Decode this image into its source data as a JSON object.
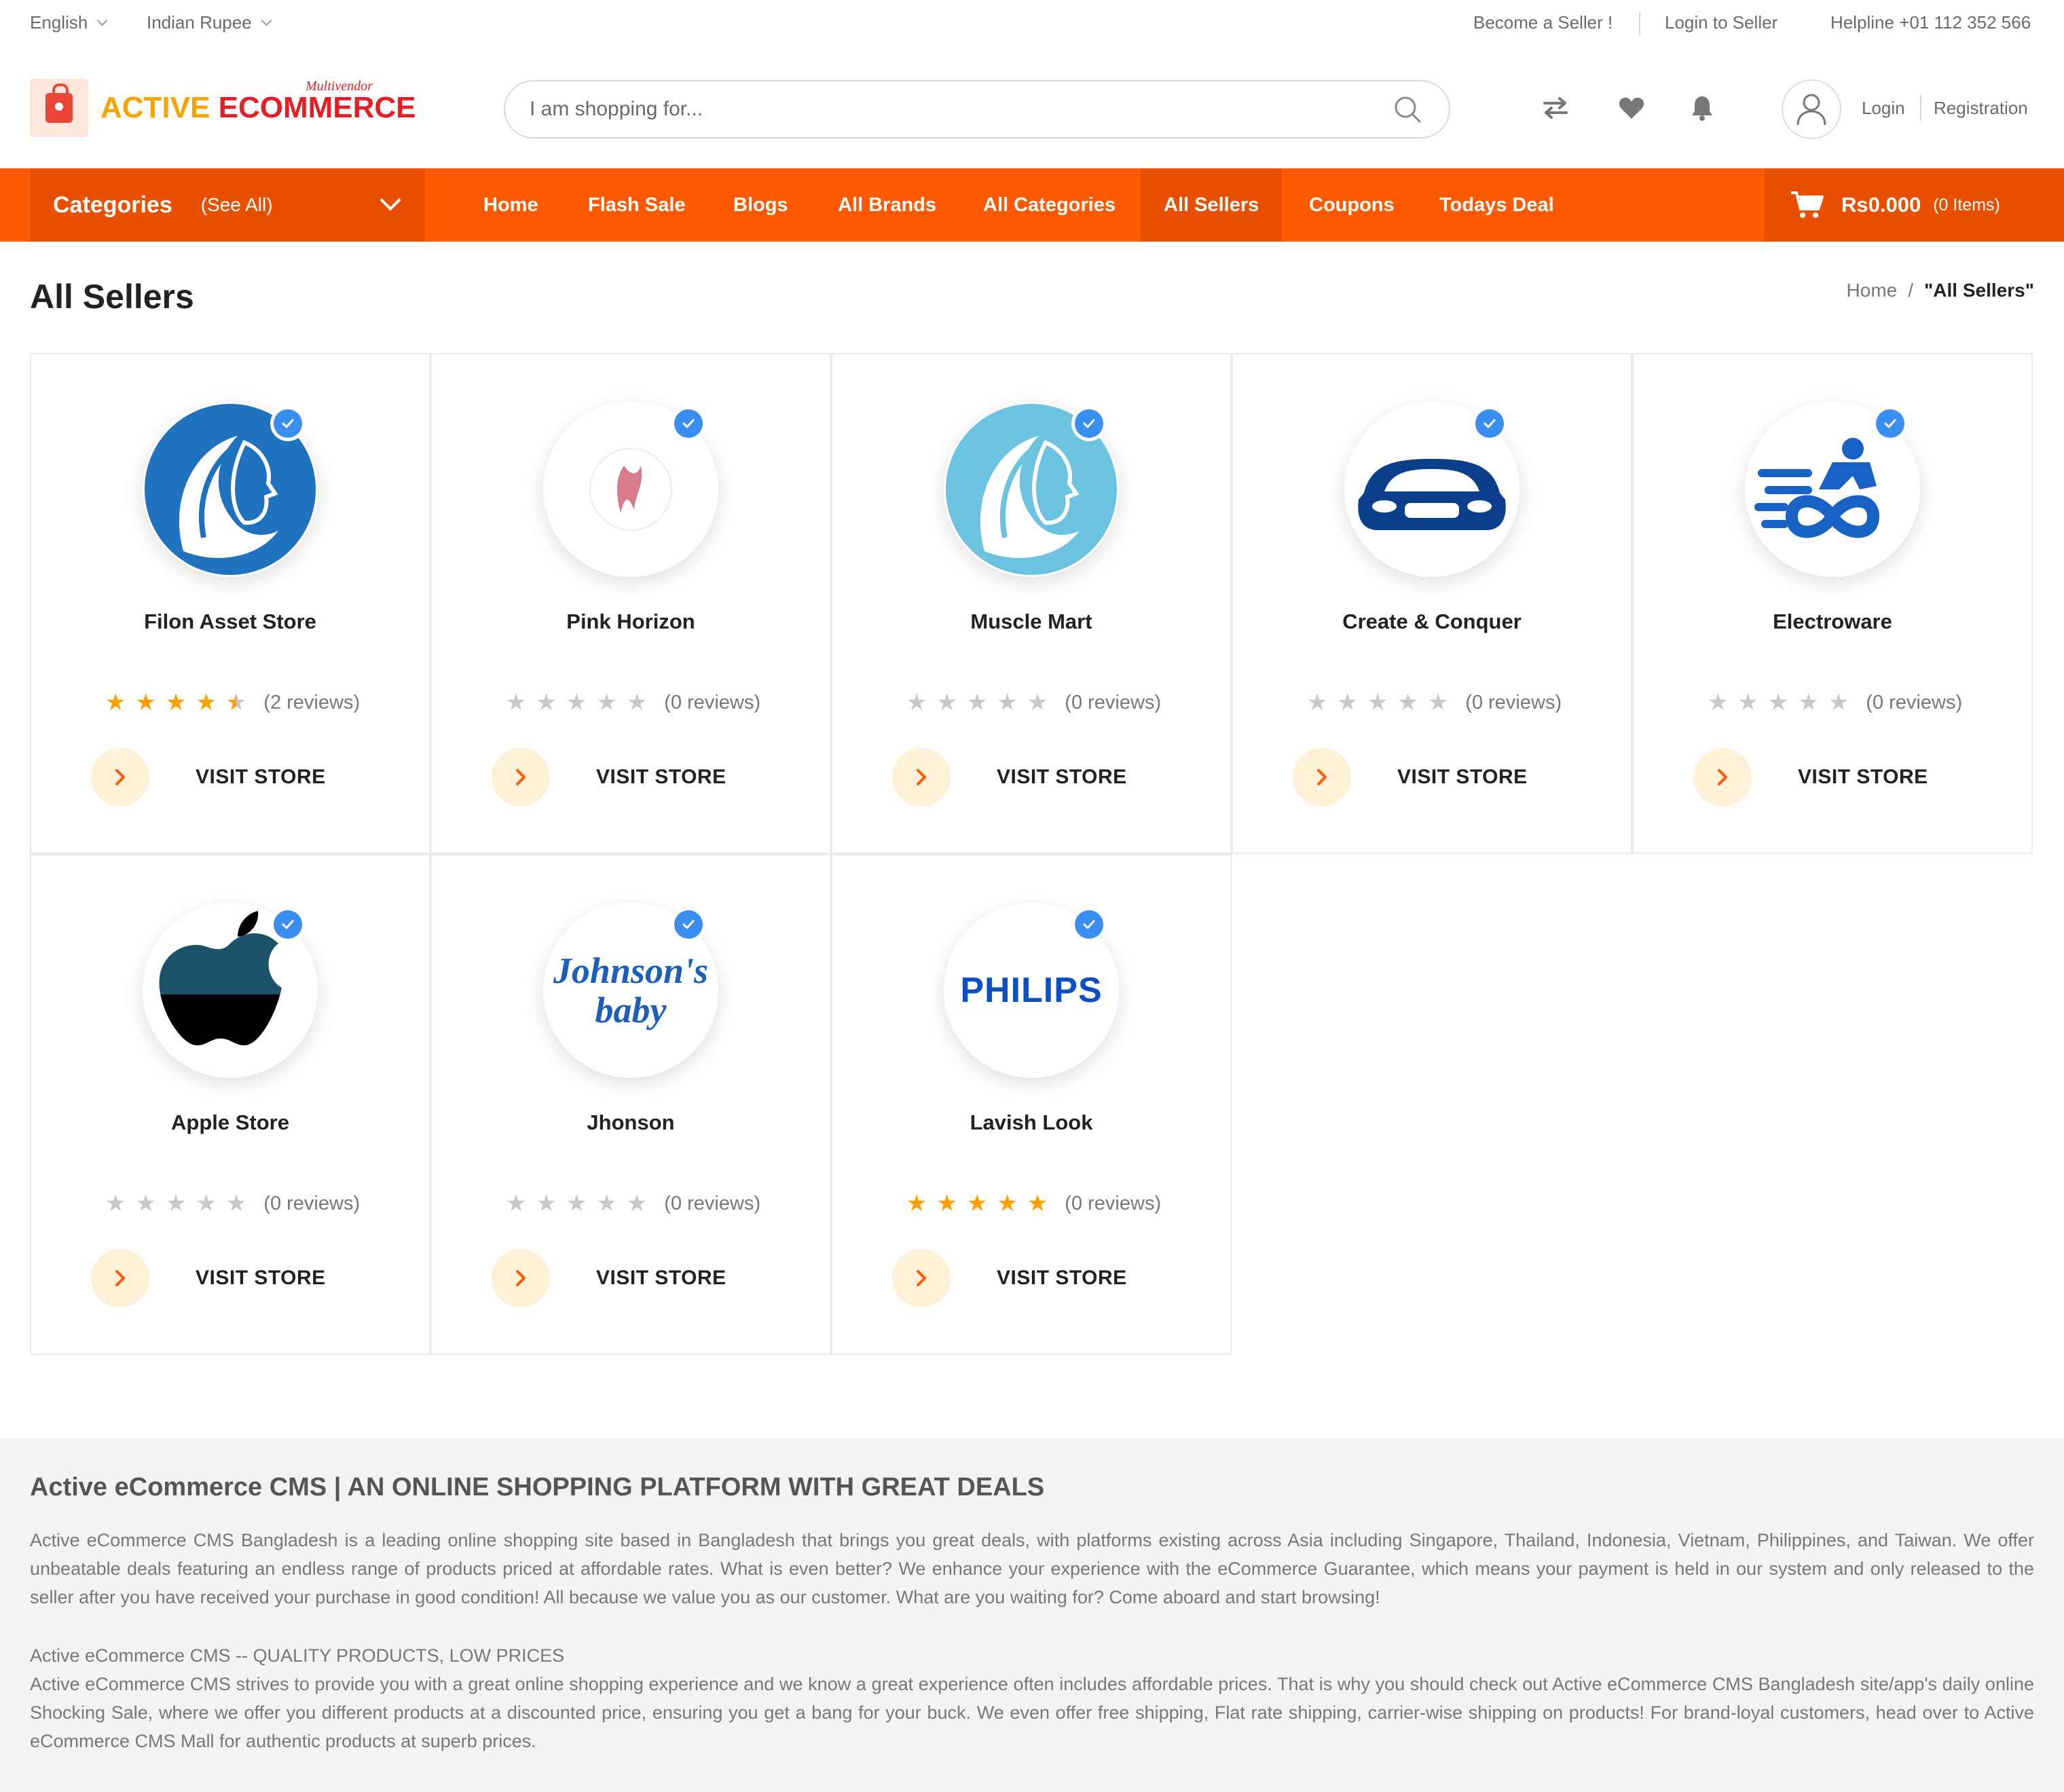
{
  "topbar": {
    "language": "English",
    "currency": "Indian Rupee",
    "become_seller": "Become a Seller !",
    "login_seller": "Login to Seller",
    "helpline": "Helpline +01 112 352 566"
  },
  "header": {
    "logo_part1": "ACTIVE",
    "logo_part2": "ECOMMERCE",
    "logo_tagline": "Multivendor",
    "search_placeholder": "I am shopping for...",
    "icons": [
      "compare-icon",
      "heart-icon",
      "bell-icon",
      "user-icon"
    ],
    "login": "Login",
    "registration": "Registration"
  },
  "nav": {
    "categories_title": "Categories",
    "categories_see_all": "(See All)",
    "links": [
      "Home",
      "Flash Sale",
      "Blogs",
      "All Brands",
      "All Categories",
      "All Sellers",
      "Coupons",
      "Todays Deal"
    ],
    "active_link": "All Sellers",
    "cart_amount": "Rs0.000",
    "cart_items": "(0 Items)"
  },
  "page": {
    "title": "All Sellers",
    "breadcrumb_home": "Home",
    "breadcrumb_sep": "/",
    "breadcrumb_current": "\"All Sellers\""
  },
  "sellers": [
    {
      "name": "Filon Asset Store",
      "rating": 4.5,
      "reviews": "(2 reviews)",
      "visit": "VISIT STORE",
      "logo": "woman-profile-logo-dark"
    },
    {
      "name": "Pink Horizon",
      "rating": 0,
      "reviews": "(0 reviews)",
      "visit": "VISIT STORE",
      "logo": "pink-hair-logo"
    },
    {
      "name": "Muscle Mart",
      "rating": 0,
      "reviews": "(0 reviews)",
      "visit": "VISIT STORE",
      "logo": "woman-profile-logo-light"
    },
    {
      "name": "Create & Conquer",
      "rating": 0,
      "reviews": "(0 reviews)",
      "visit": "VISIT STORE",
      "logo": "car-logo"
    },
    {
      "name": "Electroware",
      "rating": 0,
      "reviews": "(0 reviews)",
      "visit": "VISIT STORE",
      "logo": "cyclist-logo"
    },
    {
      "name": "Apple Store",
      "rating": 0,
      "reviews": "(0 reviews)",
      "visit": "VISIT STORE",
      "logo": "apple-logo"
    },
    {
      "name": "Jhonson",
      "rating": 0,
      "reviews": "(0 reviews)",
      "visit": "VISIT STORE",
      "logo": "johnsons-baby-logo",
      "logo_text_1": "Johnson's",
      "logo_text_2": "baby"
    },
    {
      "name": "Lavish Look",
      "rating": 5,
      "reviews": "(0 reviews)",
      "visit": "VISIT STORE",
      "logo": "philips-logo",
      "logo_text_1": "PHILIPS"
    }
  ],
  "about": {
    "heading": "Active eCommerce CMS | AN ONLINE SHOPPING PLATFORM WITH GREAT DEALS",
    "para1": "Active eCommerce CMS Bangladesh is a leading online shopping site based in Bangladesh that brings you great deals, with platforms existing across Asia including Singapore, Thailand, Indonesia, Vietnam, Philippines, and Taiwan. We offer unbeatable deals featuring an endless range of products priced at affordable rates. What is even better? We enhance your experience with the eCommerce Guarantee, which means your payment is held in our system and only released to the seller after you have received your purchase in good condition! All because we value you as our customer. What are you waiting for? Come aboard and start browsing!",
    "sub_heading": "Active eCommerce CMS -- QUALITY PRODUCTS, LOW PRICES",
    "para2": "Active eCommerce CMS strives to provide you with a great online shopping experience and we know a great experience often includes affordable prices. That is why you should check out Active eCommerce CMS Bangladesh site/app's daily online Shocking Sale, where we offer you different products at a discounted price, ensuring you get a bang for your buck. We even offer free shipping, Flat rate shipping, carrier-wise shipping on products! For brand-loyal customers, head over to Active eCommerce CMS Mall for authentic products at superb prices."
  },
  "colors": {
    "brand_orange": "#ff5a00",
    "brand_orange_dark": "#e85000",
    "star": "#ff9f00",
    "verified_blue": "#3a8ef0"
  }
}
